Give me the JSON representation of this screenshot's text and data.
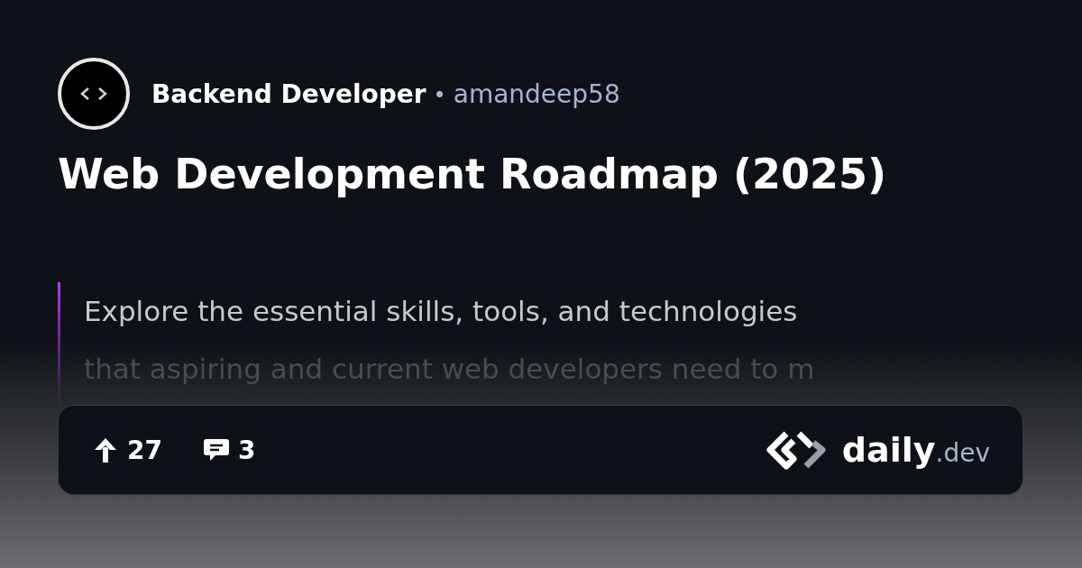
{
  "source": {
    "name": "Backend Developer",
    "separator": "•",
    "author": "amandeep58"
  },
  "title": "Web Development Roadmap (2025)",
  "excerpt_lines": [
    "Explore the essential skills, tools, and technologies",
    "that aspiring and current web developers need to m"
  ],
  "footer": {
    "upvotes": "27",
    "comments": "3",
    "brand": "daily",
    "brand_suffix": ".dev"
  }
}
